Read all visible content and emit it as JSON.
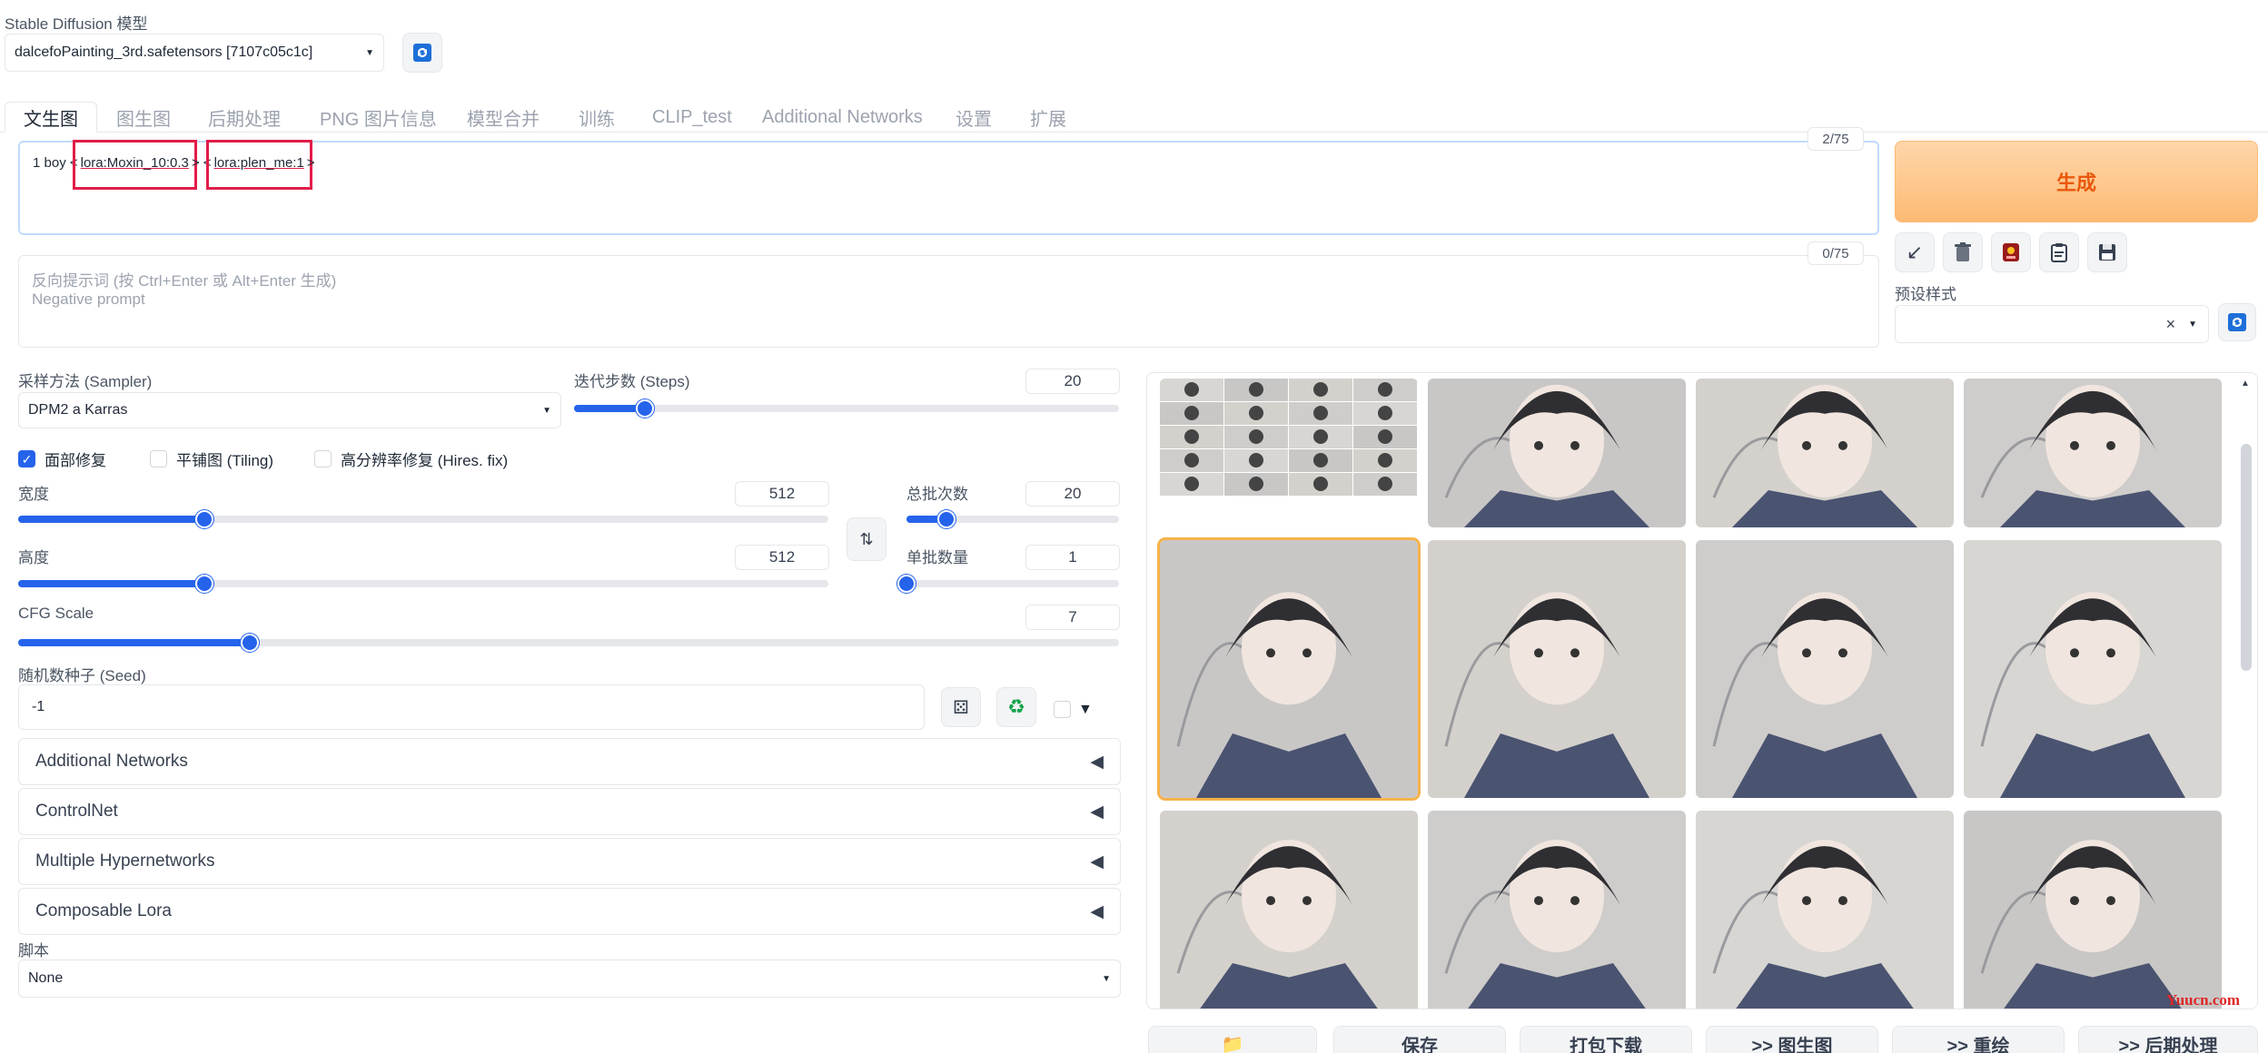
{
  "model": {
    "label": "Stable Diffusion 模型",
    "selected": "dalcefoPainting_3rd.safetensors [7107c05c1c]"
  },
  "tabs": [
    {
      "label": "文生图",
      "active": true
    },
    {
      "label": "图生图"
    },
    {
      "label": "后期处理"
    },
    {
      "label": "PNG 图片信息"
    },
    {
      "label": "模型合并"
    },
    {
      "label": "训练"
    },
    {
      "label": "CLIP_test"
    },
    {
      "label": "Additional Networks"
    },
    {
      "label": "设置"
    },
    {
      "label": "扩展"
    }
  ],
  "prompt": {
    "prefix": "1 boy <",
    "lora1": "lora:Moxin_10:0.3",
    "sep": "> <",
    "lora2": "lora:plen_me:1",
    "suffix": ">",
    "counter": "2/75"
  },
  "negative": {
    "placeholder_line1": "反向提示词 (按 Ctrl+Enter 或 Alt+Enter 生成)",
    "placeholder_line2": "Negative prompt",
    "counter": "0/75"
  },
  "generate_label": "生成",
  "styles": {
    "label": "预设样式",
    "clear": "×"
  },
  "sampler": {
    "label": "采样方法 (Sampler)",
    "value": "DPM2 a Karras"
  },
  "steps": {
    "label": "迭代步数 (Steps)",
    "value": "20",
    "fraction": 0.13
  },
  "checks": {
    "face": "面部修复",
    "tiling": "平铺图 (Tiling)",
    "hires": "高分辨率修复 (Hires. fix)"
  },
  "width": {
    "label": "宽度",
    "value": "512",
    "fraction": 0.23
  },
  "height": {
    "label": "高度",
    "value": "512",
    "fraction": 0.23
  },
  "batch_count": {
    "label": "总批次数",
    "value": "20",
    "fraction": 0.19
  },
  "batch_size": {
    "label": "单批数量",
    "value": "1",
    "fraction": 0.0
  },
  "cfg": {
    "label": "CFG Scale",
    "value": "7",
    "fraction": 0.21
  },
  "seed": {
    "label": "随机数种子 (Seed)",
    "value": "-1"
  },
  "accordions": [
    "Additional Networks",
    "ControlNet",
    "Multiple Hypernetworks",
    "Composable Lora"
  ],
  "script": {
    "label": "脚本",
    "value": "None"
  },
  "bottom_buttons": [
    "保存",
    "打包下载",
    ">> 图生图",
    ">> 重绘",
    ">> 后期处理"
  ],
  "watermark": "Yuucn.com",
  "colors": {
    "accent": "#2563eb",
    "generate": "#ea580c",
    "lora_box": "#e11d48",
    "selected_tile": "#f6b24a"
  }
}
